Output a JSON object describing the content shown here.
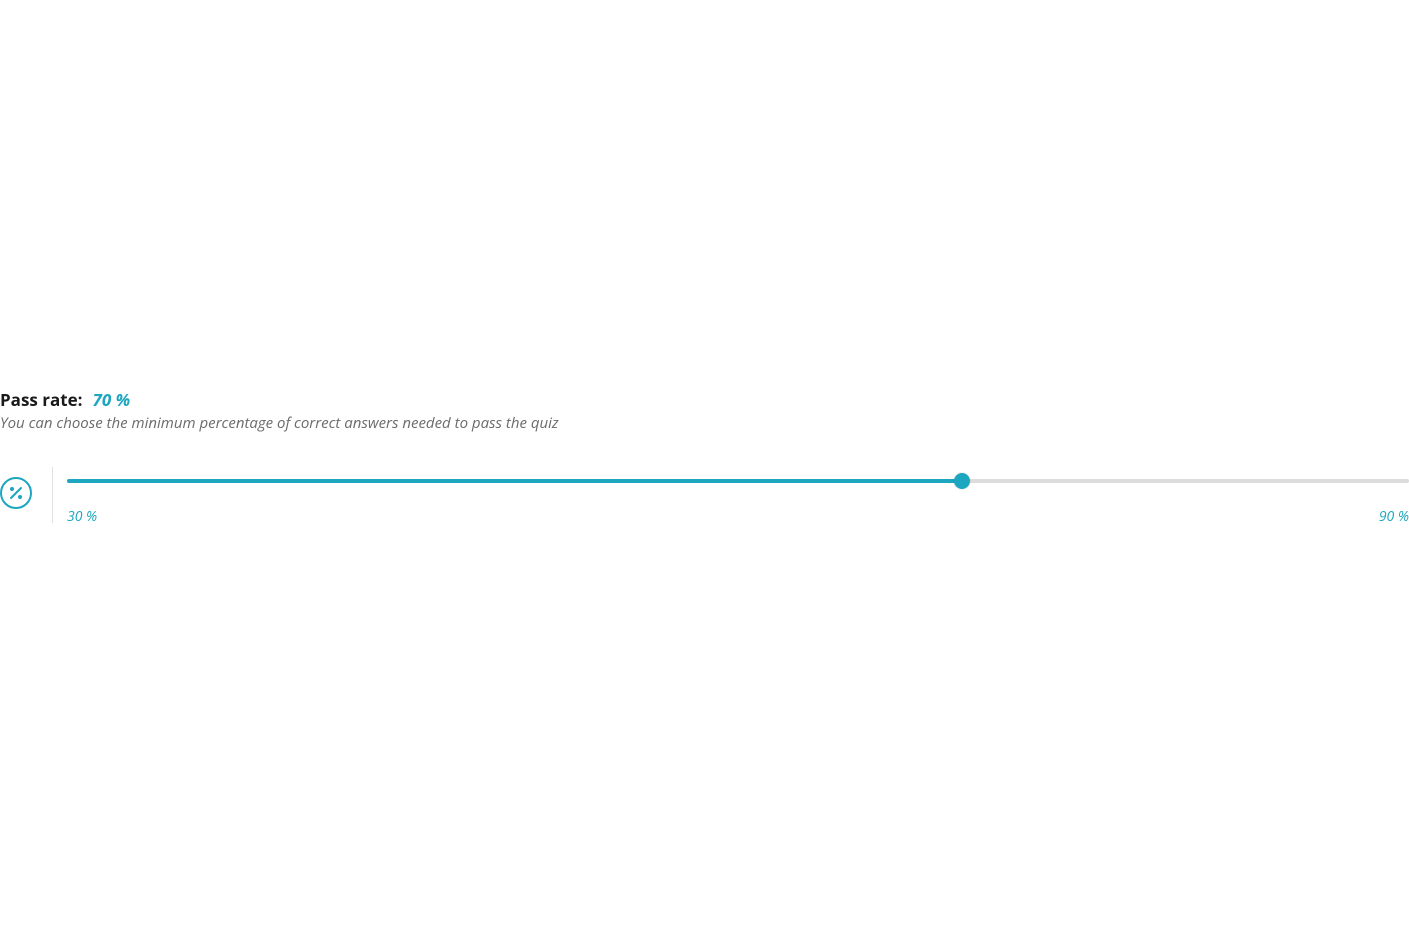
{
  "passRate": {
    "label": "Pass rate:",
    "value": "70 %",
    "description": "You can choose the minimum percentage of correct answers needed to pass the quiz",
    "icon": "percent-icon",
    "slider": {
      "min": 30,
      "max": 90,
      "current": 70,
      "minLabel": "30 %",
      "maxLabel": "90 %"
    }
  },
  "colors": {
    "accent": "#1ca6bf",
    "muted": "#6b6b6b",
    "track": "#dcdcdc"
  }
}
